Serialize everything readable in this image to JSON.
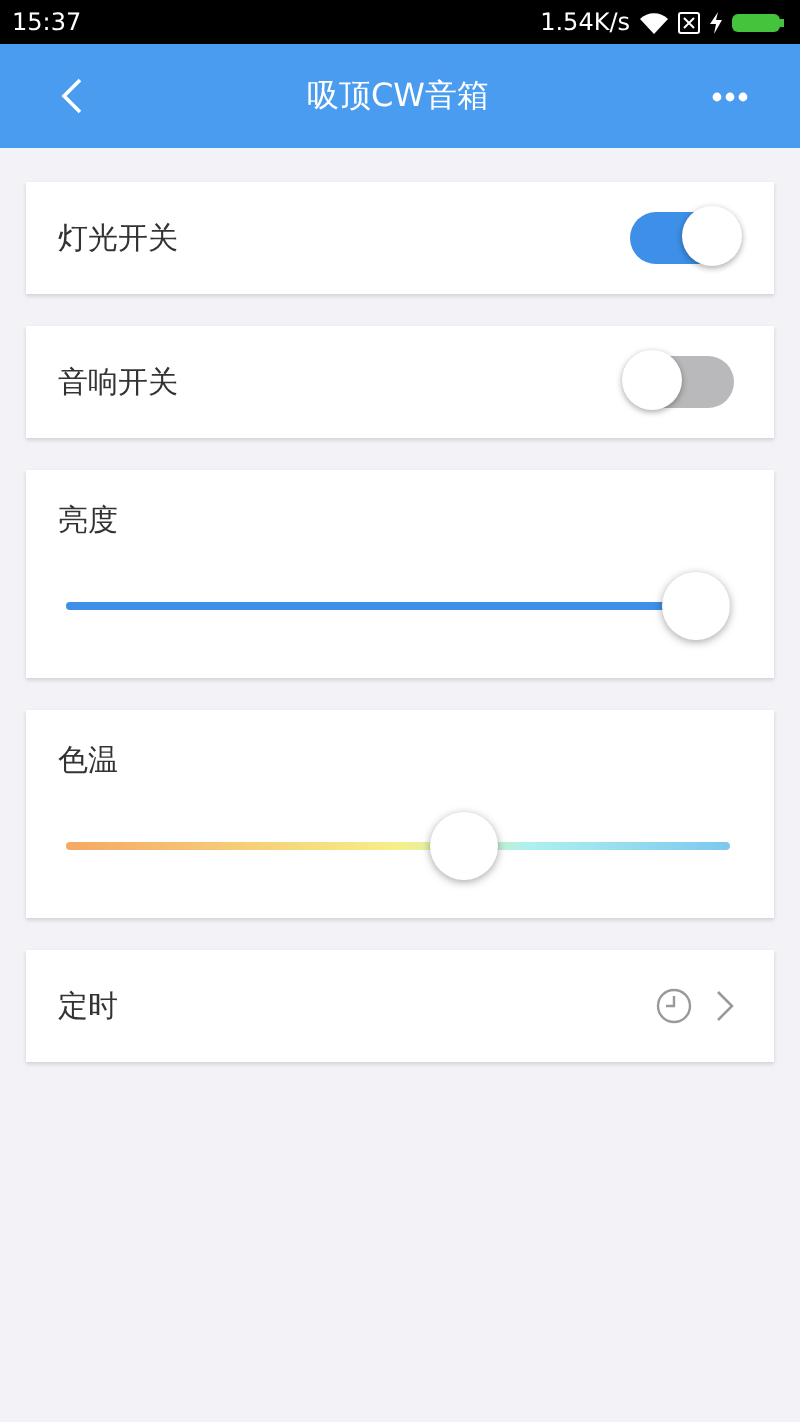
{
  "status_bar": {
    "time": "15:37",
    "speed": "1.54K/s"
  },
  "header": {
    "title": "吸顶CW音箱"
  },
  "rows": [
    {
      "kind": "switch",
      "label": "灯光开关",
      "on": true
    },
    {
      "kind": "switch",
      "label": "音响开关",
      "on": false
    },
    {
      "kind": "slider",
      "label": "亮度",
      "level": 0.95
    },
    {
      "kind": "temperature",
      "label": "色温",
      "level": 0.6
    },
    {
      "kind": "timer",
      "label": "定时"
    }
  ]
}
